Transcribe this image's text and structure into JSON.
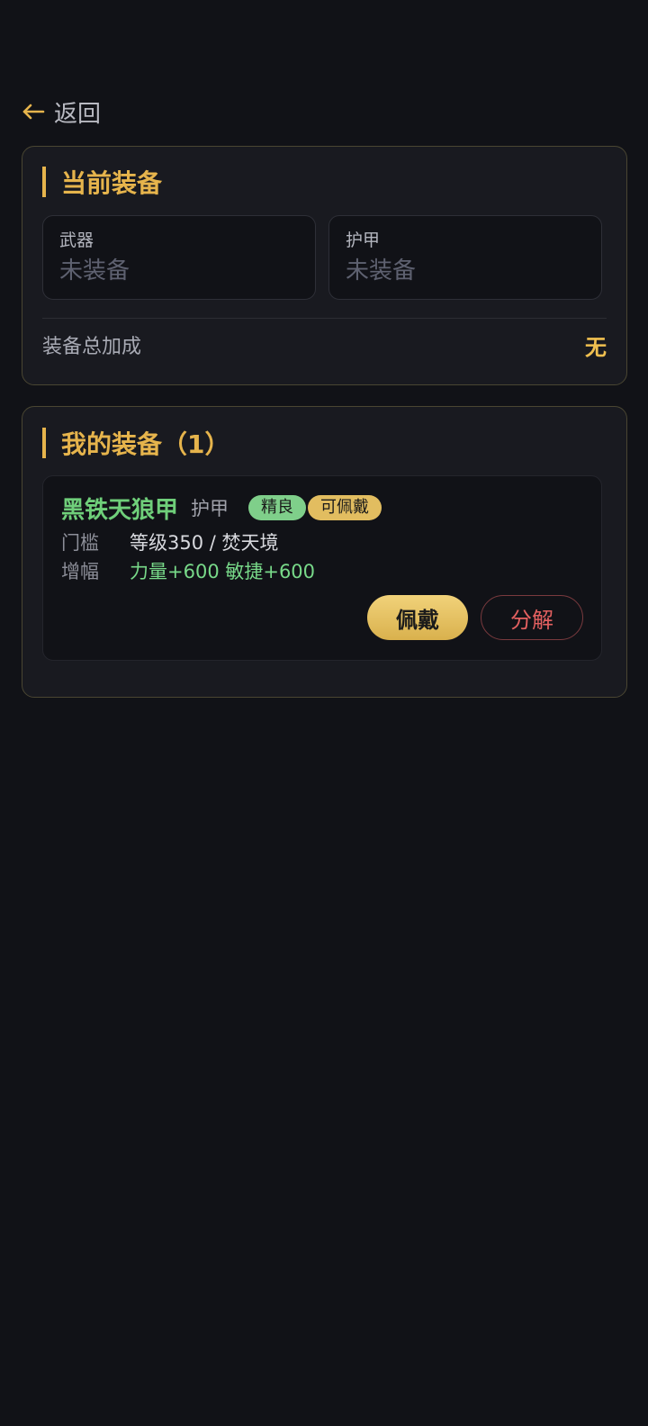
{
  "nav": {
    "back_label": "返回"
  },
  "current_equipment": {
    "title": "当前装备",
    "weapon": {
      "label": "武器",
      "value": "未装备"
    },
    "armor": {
      "label": "护甲",
      "value": "未装备"
    },
    "total_bonus_label": "装备总加成",
    "total_bonus_value": "无"
  },
  "my_equipment": {
    "title": "我的装备（1）",
    "items": [
      {
        "name": "黑铁天狼甲",
        "type": "护甲",
        "quality_badge": "精良",
        "status_badge": "可佩戴",
        "requirement_label": "门槛",
        "requirement_value": "等级350 / 焚天境",
        "bonus_label": "增幅",
        "bonus_value": "力量+600 敏捷+600",
        "equip_button": "佩戴",
        "salvage_button": "分解"
      }
    ]
  },
  "colors": {
    "accent_gold": "#e6b44c",
    "item_green": "#6fcf7a",
    "danger_red": "#e36060",
    "background": "#111217"
  }
}
